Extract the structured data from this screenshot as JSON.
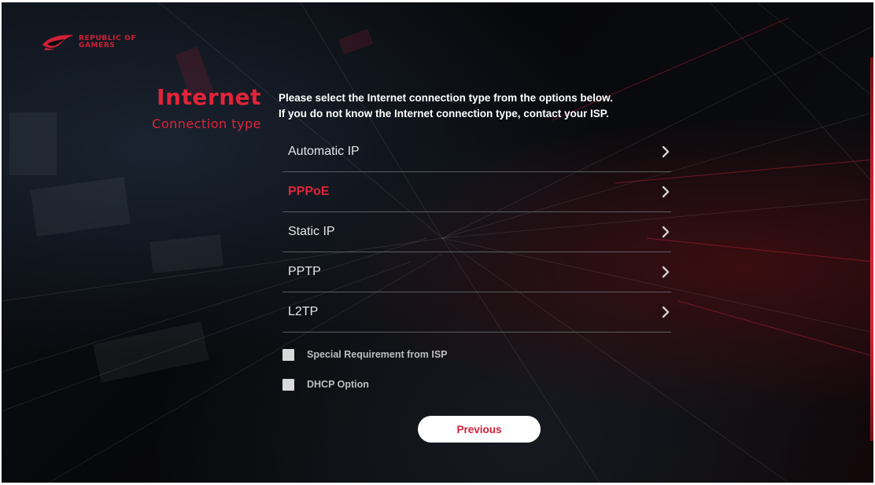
{
  "brand": {
    "logo_line1": "REPUBLIC OF",
    "logo_line2": "GAMERS",
    "accent_color": "#e0243a"
  },
  "header": {
    "title": "Internet",
    "subtitle": "Connection type"
  },
  "description": {
    "line1": "Please select the Internet connection type from the options below.",
    "line2": "If you do not know the Internet connection type, contact your ISP."
  },
  "options": [
    {
      "label": "Automatic IP",
      "icon": "chevron-right-icon",
      "selected": false
    },
    {
      "label": "PPPoE",
      "icon": "chevron-right-icon",
      "selected": true
    },
    {
      "label": "Static IP",
      "icon": "chevron-right-icon",
      "selected": false
    },
    {
      "label": "PPTP",
      "icon": "chevron-right-icon",
      "selected": false
    },
    {
      "label": "L2TP",
      "icon": "chevron-right-icon",
      "selected": false
    }
  ],
  "checkboxes": [
    {
      "label": "Special Requirement from ISP",
      "checked": false
    },
    {
      "label": "DHCP Option",
      "checked": false
    }
  ],
  "buttons": {
    "previous": "Previous"
  }
}
